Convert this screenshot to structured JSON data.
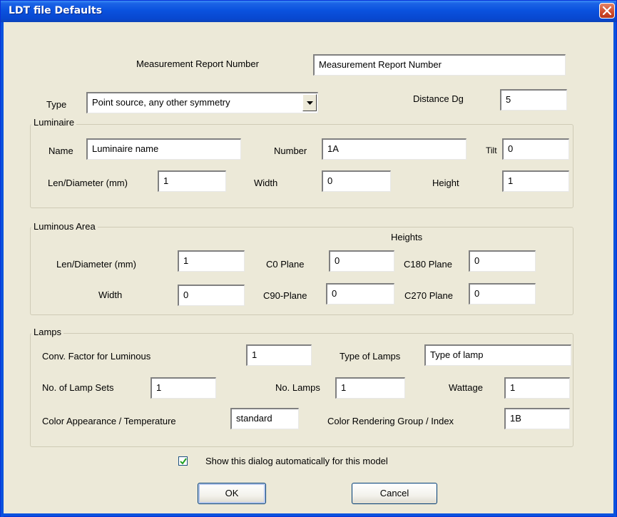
{
  "window": {
    "title": "LDT file Defaults"
  },
  "header": {
    "measurement_report_label": "Measurement Report Number",
    "measurement_report_value": "Measurement Report Number",
    "type_label": "Type",
    "type_value": "Point source, any other symmetry",
    "distance_label": "Distance Dg",
    "distance_value": "5"
  },
  "luminaire": {
    "group_label": "Luminaire",
    "name_label": "Name",
    "name_value": "Luminaire name",
    "number_label": "Number",
    "number_value": "1A",
    "tilt_label": "Tilt",
    "tilt_value": "0",
    "len_label": "Len/Diameter (mm)",
    "len_value": "1",
    "width_label": "Width",
    "width_value": "0",
    "height_label": "Height",
    "height_value": "1"
  },
  "luminous_area": {
    "group_label": "Luminous Area",
    "heights_label": "Heights",
    "len_label": "Len/Diameter (mm)",
    "len_value": "1",
    "width_label": "Width",
    "width_value": "0",
    "c0_label": "C0 Plane",
    "c0_value": "0",
    "c90_label": "C90-Plane",
    "c90_value": "0",
    "c180_label": "C180 Plane",
    "c180_value": "0",
    "c270_label": "C270 Plane",
    "c270_value": "0"
  },
  "lamps": {
    "group_label": "Lamps",
    "conv_label": "Conv. Factor for Luminous",
    "conv_value": "1",
    "type_label": "Type of Lamps",
    "type_value": "Type of lamp",
    "sets_label": "No. of Lamp Sets",
    "sets_value": "1",
    "num_label": "No. Lamps",
    "num_value": "1",
    "wattage_label": "Wattage",
    "wattage_value": "1",
    "color_label": "Color Appearance / Temperature",
    "color_value": "standard",
    "rendering_label": "Color Rendering Group / Index",
    "rendering_value": "1B"
  },
  "footer": {
    "show_dialog_label": "Show this dialog automatically for this model",
    "show_dialog_checked": true,
    "ok_label": "OK",
    "cancel_label": "Cancel"
  },
  "colors": {
    "titlebar": "#0a52de",
    "dialog_bg": "#ece9d8",
    "close_button": "#cf4a2a"
  }
}
